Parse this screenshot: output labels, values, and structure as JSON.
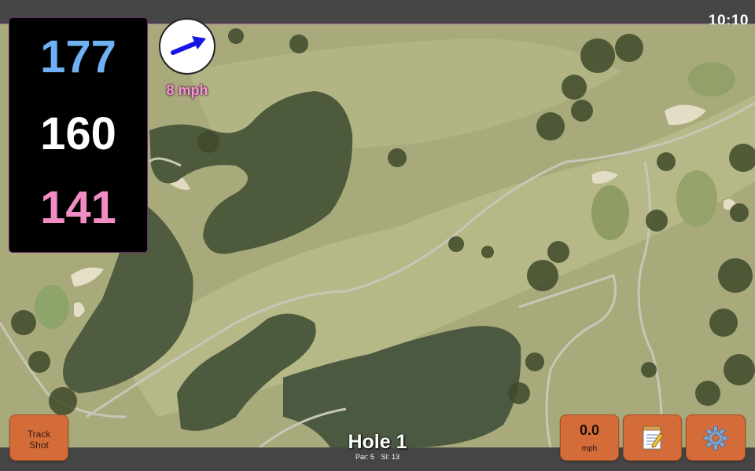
{
  "status_bar": {
    "time": "10:10"
  },
  "distances": {
    "back": "177",
    "center": "160",
    "front": "141"
  },
  "wind": {
    "speed": "8 mph",
    "icon": "wind-direction-arrow-icon"
  },
  "hole": {
    "title": "Hole 1",
    "par": "Par: 5",
    "stroke_index": "SI: 13"
  },
  "buttons": {
    "track_shot_line1": "Track",
    "track_shot_line2": "Shot",
    "speed_value": "0.0",
    "speed_unit": "mph",
    "notes_icon": "notepad-icon",
    "settings_icon": "gear-icon"
  },
  "colors": {
    "back_distance": "#6eb2f5",
    "center_distance": "#ffffff",
    "front_distance": "#f28cc4",
    "button": "#d46c3a",
    "wind_text": "#f29ad2"
  }
}
